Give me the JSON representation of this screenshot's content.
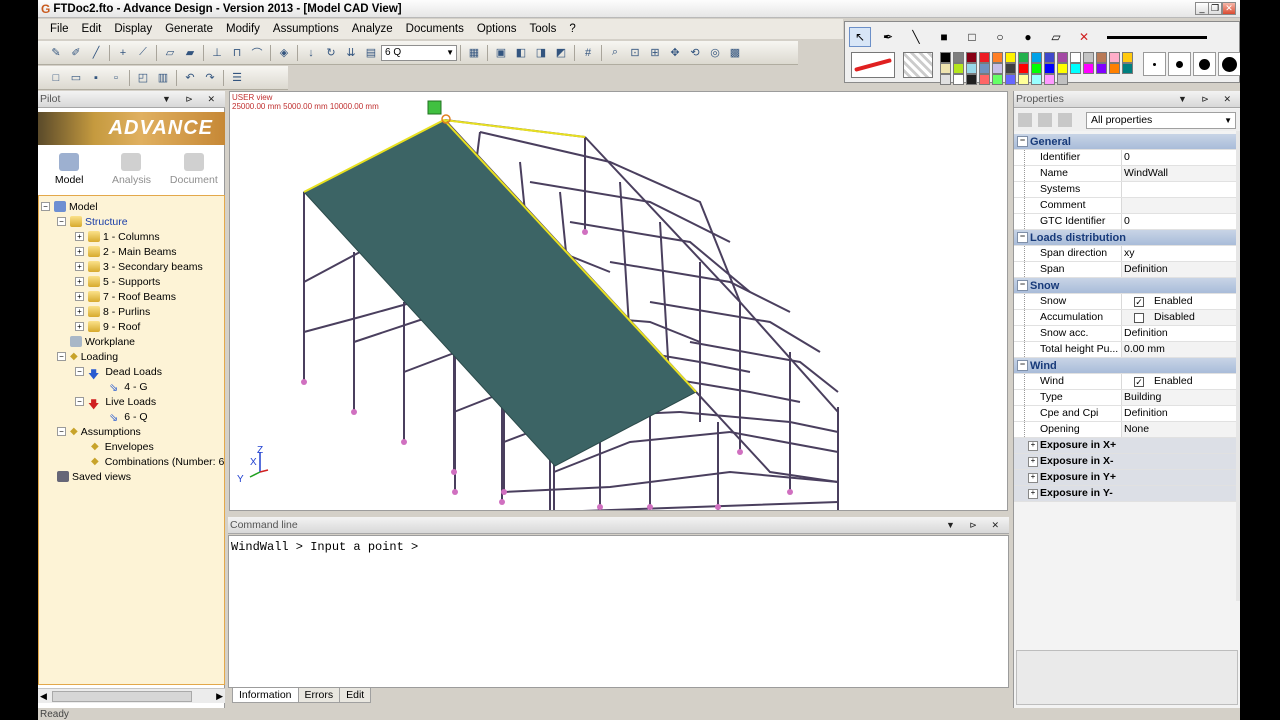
{
  "window": {
    "title": "FTDoc2.fto - Advance Design - Version 2013 - [Model CAD View]"
  },
  "menu": [
    "File",
    "Edit",
    "Display",
    "Generate",
    "Modify",
    "Assumptions",
    "Analyze",
    "Documents",
    "Options",
    "Tools",
    "?"
  ],
  "toolbar": {
    "loadcase_combo": "6 Q"
  },
  "paint_palette": {
    "colors": [
      "#000000",
      "#7f7f7f",
      "#880015",
      "#ed1c24",
      "#ff7f27",
      "#fff200",
      "#22b14c",
      "#00a2e8",
      "#3f48cc",
      "#a349a4",
      "#ffffff",
      "#c3c3c3",
      "#b97a57",
      "#ffaec9",
      "#ffc90e",
      "#efe4b0",
      "#b5e61d",
      "#99d9ea",
      "#7092be",
      "#c8bfe7",
      "#404040",
      "#ff0000",
      "#00ff00",
      "#0000ff",
      "#ffff00",
      "#00ffff",
      "#ff00ff",
      "#8000ff",
      "#ff8000",
      "#008080",
      "#e0e0e0",
      "#ffffff",
      "#202020",
      "#ff6666",
      "#66ff66",
      "#6666ff",
      "#ffff99",
      "#99ffff",
      "#ff99ff",
      "#c0c0c0"
    ]
  },
  "pilot": {
    "title": "Pilot",
    "logo_text": "ADVANCE",
    "modes": [
      "Model",
      "Analysis",
      "Document"
    ],
    "tree": [
      {
        "label": "Model",
        "level": 0
      },
      {
        "label": "Structure",
        "level": 1
      },
      {
        "label": "1 - Columns",
        "level": 2
      },
      {
        "label": "2 - Main Beams",
        "level": 2
      },
      {
        "label": "3 - Secondary beams",
        "level": 2
      },
      {
        "label": "5 - Supports",
        "level": 2
      },
      {
        "label": "7 - Roof Beams",
        "level": 2
      },
      {
        "label": "8 - Purlins",
        "level": 2
      },
      {
        "label": "9 - Roof",
        "level": 2
      },
      {
        "label": "Workplane",
        "level": 1
      },
      {
        "label": "Loading",
        "level": 1
      },
      {
        "label": "Dead Loads",
        "level": 2
      },
      {
        "label": "4 - G",
        "level": 3
      },
      {
        "label": "Live Loads",
        "level": 2
      },
      {
        "label": "6 - Q",
        "level": 3
      },
      {
        "label": "Assumptions",
        "level": 1
      },
      {
        "label": "Envelopes",
        "level": 2
      },
      {
        "label": "Combinations (Number: 6",
        "level": 2
      },
      {
        "label": "Saved views",
        "level": 0
      }
    ]
  },
  "cad": {
    "view_name": "USER view",
    "scale_text": "25000.00 mm  5000.00 mm  10000.00 mm",
    "axis_x": "X",
    "axis_y": "Y",
    "axis_z": "Z"
  },
  "command": {
    "title": "Command line",
    "text": "WindWall > Input a point >",
    "tabs": [
      "Information",
      "Errors",
      "Edit"
    ]
  },
  "properties": {
    "title": "Properties",
    "filter": "All properties",
    "sections": [
      {
        "name": "General",
        "rows": [
          {
            "k": "Identifier",
            "v": "0"
          },
          {
            "k": "Name",
            "v": "WindWall"
          },
          {
            "k": "Systems",
            "v": ""
          },
          {
            "k": "Comment",
            "v": ""
          },
          {
            "k": "GTC Identifier",
            "v": "0"
          }
        ]
      },
      {
        "name": "Loads distribution",
        "rows": [
          {
            "k": "Span direction",
            "v": "xy"
          },
          {
            "k": "Span",
            "v": "Definition"
          }
        ]
      },
      {
        "name": "Snow",
        "rows": [
          {
            "k": "Snow",
            "v": "Enabled",
            "check": true
          },
          {
            "k": "Accumulation",
            "v": "Disabled",
            "check": false
          },
          {
            "k": "Snow acc.",
            "v": "Definition"
          },
          {
            "k": "Total height Pu...",
            "v": "0.00 mm"
          }
        ]
      },
      {
        "name": "Wind",
        "rows": [
          {
            "k": "Wind",
            "v": "Enabled",
            "check": true
          },
          {
            "k": "Type",
            "v": "Building"
          },
          {
            "k": "Cpe and Cpi",
            "v": "Definition"
          },
          {
            "k": "Opening",
            "v": "None"
          }
        ]
      }
    ],
    "exposures": [
      "Exposure in X+",
      "Exposure in X-",
      "Exposure in Y+",
      "Exposure in Y-"
    ]
  },
  "status": {
    "text": "Ready"
  }
}
